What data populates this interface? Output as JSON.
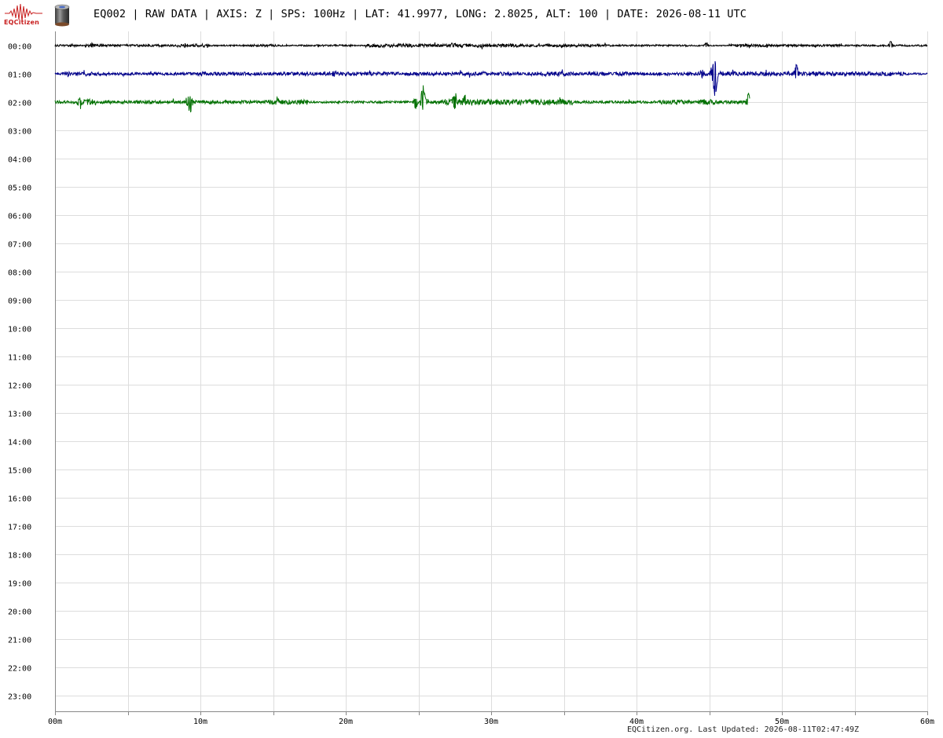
{
  "header": {
    "logo_text": "EQCitizen",
    "title": "EQ002 | RAW DATA | AXIS: Z | SPS: 100Hz | LAT: 41.9977, LONG: 2.8025, ALT: 100 | DATE: 2026-08-11 UTC"
  },
  "footer": {
    "text": "EQCitizen.org. Last Updated: 2026-08-11T02:47:49Z"
  },
  "colors": {
    "logo": "#c81e1e",
    "grid": "#dddddd",
    "axis": "#888888"
  },
  "chart_data": {
    "type": "line",
    "title": "",
    "xlabel": "",
    "ylabel": "",
    "xlim": [
      0,
      60
    ],
    "x_ticks": [
      "00m",
      "10m",
      "20m",
      "30m",
      "40m",
      "50m",
      "60m"
    ],
    "x_minor_ticks_every_min": 5,
    "y_rows": [
      "00:00",
      "01:00",
      "02:00",
      "03:00",
      "04:00",
      "05:00",
      "06:00",
      "07:00",
      "08:00",
      "09:00",
      "10:00",
      "11:00",
      "12:00",
      "13:00",
      "14:00",
      "15:00",
      "16:00",
      "17:00",
      "18:00",
      "19:00",
      "20:00",
      "21:00",
      "22:00",
      "23:00"
    ],
    "grid": true,
    "series": [
      {
        "hour": "00:00",
        "color": "#000000",
        "start_min": 0,
        "end_min": 60,
        "noise": 1.2,
        "spikes": [
          {
            "min": 2.5,
            "amp": 2.5
          },
          {
            "min": 27.4,
            "amp": 3.5
          },
          {
            "min": 44.8,
            "amp": 3.5
          },
          {
            "min": 57.5,
            "amp": 6
          }
        ]
      },
      {
        "hour": "01:00",
        "color": "#00008b",
        "start_min": 0,
        "end_min": 60,
        "noise": 1.6,
        "spikes": [
          {
            "min": 19.2,
            "amp": 3
          },
          {
            "min": 29.5,
            "amp": 3
          },
          {
            "min": 44.5,
            "amp": 5
          },
          {
            "min": 45.2,
            "amp": 9
          },
          {
            "min": 45.4,
            "amp": -32
          },
          {
            "min": 51.0,
            "amp": 11
          },
          {
            "min": 58.2,
            "amp": 4
          }
        ]
      },
      {
        "hour": "02:00",
        "color": "#007000",
        "start_min": 0,
        "end_min": 47.8,
        "noise": 2.1,
        "spikes": [
          {
            "min": 1.7,
            "amp": -9
          },
          {
            "min": 9.1,
            "amp": 6
          },
          {
            "min": 9.3,
            "amp": -13
          },
          {
            "min": 15.3,
            "amp": 4
          },
          {
            "min": 24.8,
            "amp": -9
          },
          {
            "min": 25.3,
            "amp": 20
          },
          {
            "min": 27.5,
            "amp": 11
          },
          {
            "min": 28.2,
            "amp": 6
          },
          {
            "min": 47.7,
            "amp": 10
          }
        ]
      }
    ]
  }
}
